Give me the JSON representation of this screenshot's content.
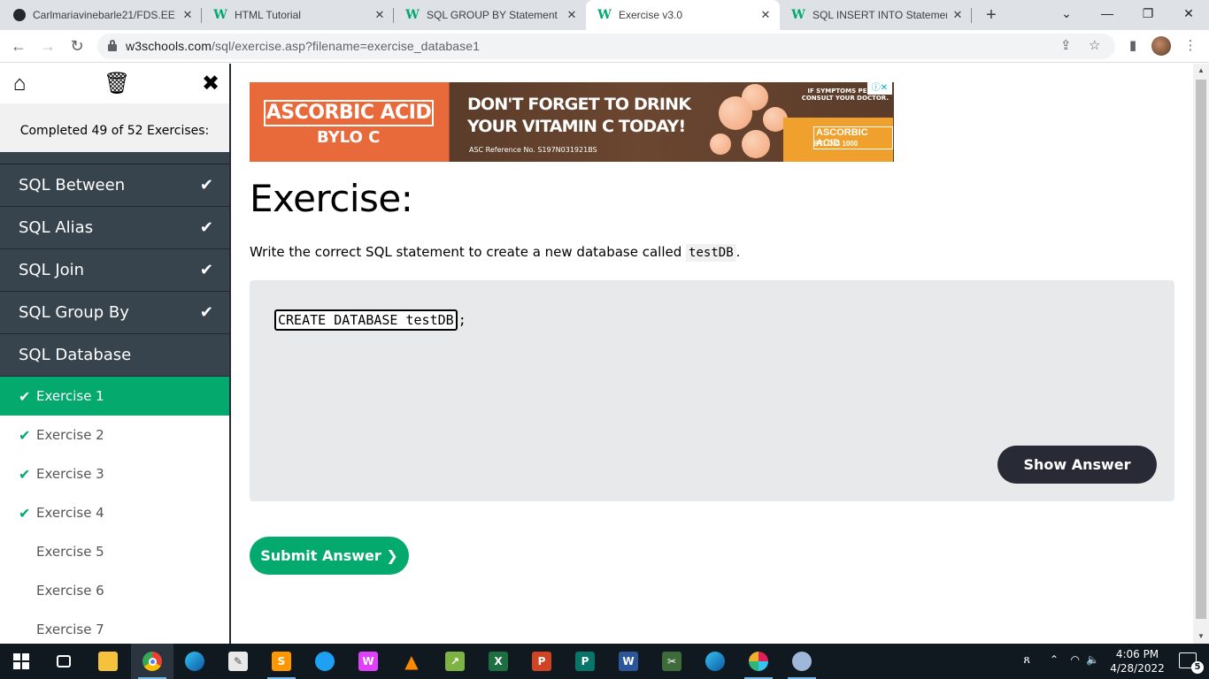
{
  "browser": {
    "tabs": [
      {
        "title": "Carlmariavinebarle21/FDS.EE",
        "favicon": "github-icon",
        "active": false
      },
      {
        "title": "HTML Tutorial",
        "favicon": "w3schools-icon",
        "active": false
      },
      {
        "title": "SQL GROUP BY Statement",
        "favicon": "w3schools-icon",
        "active": false
      },
      {
        "title": "Exercise v3.0",
        "favicon": "w3schools-icon",
        "active": true
      },
      {
        "title": "SQL INSERT INTO Statement",
        "favicon": "w3schools-icon",
        "active": false
      }
    ],
    "url_host": "w3schools.com",
    "url_path": "/sql/exercise.asp?filename=exercise_database1"
  },
  "sidebar": {
    "progress_text": "Completed 49 of 52 Exercises:",
    "sections": [
      {
        "label": "SQL Between",
        "done": true
      },
      {
        "label": "SQL Alias",
        "done": true
      },
      {
        "label": "SQL Join",
        "done": true
      },
      {
        "label": "SQL Group By",
        "done": true
      },
      {
        "label": "SQL Database",
        "done": false
      }
    ],
    "exercises": [
      {
        "label": "Exercise 1",
        "done": true,
        "active": true
      },
      {
        "label": "Exercise 2",
        "done": true,
        "active": false
      },
      {
        "label": "Exercise 3",
        "done": true,
        "active": false
      },
      {
        "label": "Exercise 4",
        "done": true,
        "active": false
      },
      {
        "label": "Exercise 5",
        "done": false,
        "active": false
      },
      {
        "label": "Exercise 6",
        "done": false,
        "active": false
      },
      {
        "label": "Exercise 7",
        "done": false,
        "active": false
      }
    ]
  },
  "ad": {
    "brand_line1": "ASCORBIC ACID",
    "brand_line2": "BYLO C",
    "headline1": "DON'T FORGET TO DRINK",
    "headline2": "YOUR VITAMIN C TODAY!",
    "reference": "ASC Reference No. S197N031921BS",
    "warning": "IF SYMPTOMS PERSIST, CONSULT YOUR DOCTOR.",
    "pack_label": "ASCORBIC ACID",
    "pack_sub": "BYLO C 1000"
  },
  "exercise": {
    "title": "Exercise:",
    "instruction_prefix": "Write the correct SQL statement to create a new database called ",
    "instruction_code": "testDB",
    "instruction_suffix": ".",
    "answer_value": "CREATE DATABASE testDB",
    "code_suffix": ";",
    "show_answer_label": "Show Answer",
    "submit_label": "Submit Answer ❯"
  },
  "taskbar": {
    "time": "4:06 PM",
    "date": "4/28/2022",
    "notification_count": "5"
  },
  "colors": {
    "accent": "#04aa6d",
    "sidebar_dark": "#38444d",
    "button_dark": "#282a35"
  }
}
